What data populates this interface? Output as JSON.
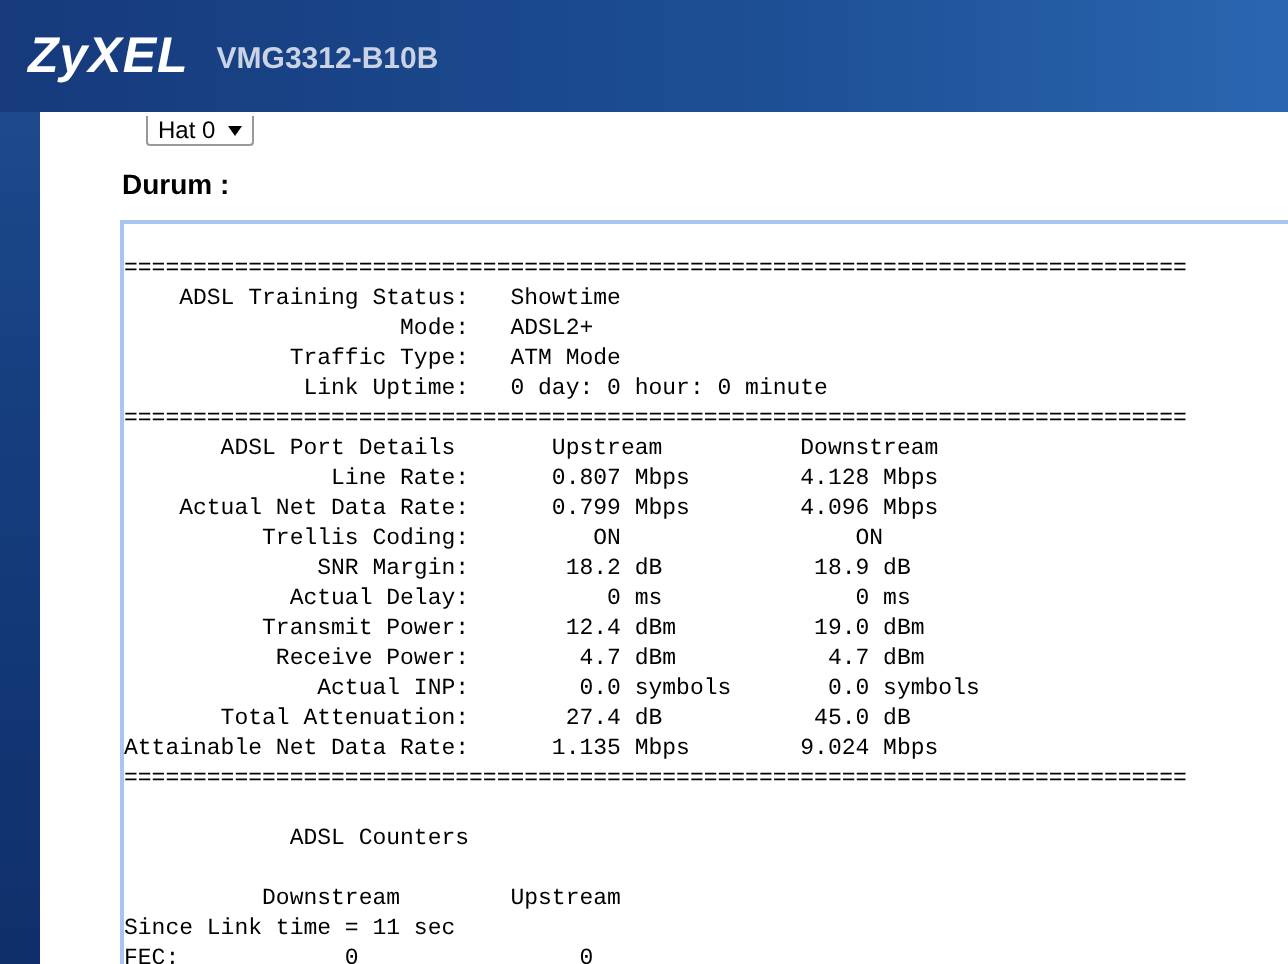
{
  "header": {
    "logo": "ZyXEL",
    "model": "VMG3312-B10B"
  },
  "line_select": {
    "value": "Hat 0"
  },
  "status_label": "Durum :",
  "status_blocks": [
    [
      "=============================================================================",
      "    ADSL Training Status:   Showtime",
      "                    Mode:   ADSL2+",
      "            Traffic Type:   ATM Mode",
      "             Link Uptime:   0 day: 0 hour: 0 minute",
      "=============================================================================",
      "       ADSL Port Details       Upstream          Downstream",
      "               Line Rate:      0.807 Mbps        4.128 Mbps",
      "    Actual Net Data Rate:      0.799 Mbps        4.096 Mbps",
      "          Trellis Coding:         ON                 ON",
      "              SNR Margin:       18.2 dB           18.9 dB",
      "            Actual Delay:          0 ms              0 ms",
      "          Transmit Power:       12.4 dBm          19.0 dBm",
      "           Receive Power:        4.7 dBm           4.7 dBm",
      "              Actual INP:        0.0 symbols       0.0 symbols",
      "       Total Attenuation:       27.4 dB           45.0 dB",
      "Attainable Net Data Rate:      1.135 Mbps        9.024 Mbps",
      "============================================================================="
    ],
    [
      "            ADSL Counters"
    ],
    [
      "          Downstream        Upstream",
      "Since Link time = 11 sec",
      "FEC:            0                0"
    ]
  ]
}
